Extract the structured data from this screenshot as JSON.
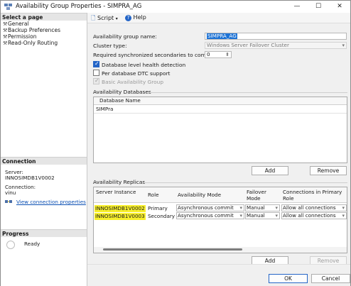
{
  "window": {
    "title": "Availability Group Properties - SIMPRA_AG",
    "controls": [
      "—",
      "☐",
      "✕"
    ]
  },
  "left_pane": {
    "select_page_header": "Select a page",
    "pages": [
      "General",
      "Backup Preferences",
      "Permission",
      "Read-Only Routing"
    ],
    "connection_header": "Connection",
    "server_label": "Server:",
    "server_value": "INNOSIMDB1V0002",
    "connection_label": "Connection:",
    "connection_value": "vinu",
    "view_connection_link": "View connection properties",
    "progress_header": "Progress",
    "progress_status": "Ready"
  },
  "toolbar": {
    "script_label": "Script",
    "help_label": "Help"
  },
  "general": {
    "ag_name_label": "Availability group name:",
    "ag_name_value": "SIMPRA_AG",
    "cluster_type_label": "Cluster type:",
    "cluster_type_value": "Windows Server Failover Cluster",
    "req_sync_label": "Required synchronized secondaries to commit:",
    "req_sync_value": "0",
    "db_health_label": "Database level health detection",
    "db_health_checked": true,
    "per_db_dtc_label": "Per database DTC support",
    "per_db_dtc_checked": false,
    "basic_ag_label": "Basic Availability Group",
    "basic_ag_checked": true
  },
  "availability_databases": {
    "group_label": "Availability Databases",
    "column_header": "Database Name",
    "rows": [
      "SIMPra"
    ],
    "add_label": "Add",
    "remove_label": "Remove"
  },
  "availability_replicas": {
    "group_label": "Availability Replicas",
    "headers": {
      "server_instance": "Server Instance",
      "role": "Role",
      "availability_mode": "Availability Mode",
      "failover_mode": "Failover Mode",
      "connections_primary": "Connections in Primary Role"
    },
    "rows": [
      {
        "server": "INNOSIMDB1V0002",
        "role": "Primary",
        "mode": "Asynchronous commit",
        "failover": "Manual",
        "connections": "Allow all connections"
      },
      {
        "server": "INNOSIMDB1V0003",
        "role": "Secondary",
        "mode": "Asynchronous commit",
        "failover": "Manual",
        "connections": "Allow all connections"
      }
    ],
    "highlight_color": "#f7ef2c",
    "add_label": "Add",
    "remove_label": "Remove"
  },
  "footer": {
    "ok_label": "OK",
    "cancel_label": "Cancel"
  },
  "colors": {
    "accent": "#2465c7",
    "link": "#0b4fb3",
    "selection": "#1d73d6"
  }
}
